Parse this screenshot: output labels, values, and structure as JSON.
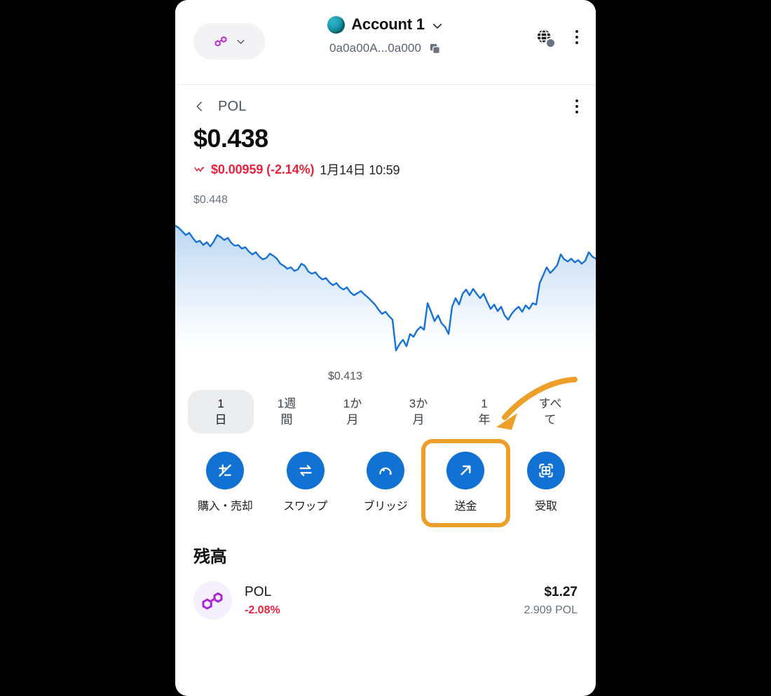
{
  "header": {
    "network_pill": {
      "icon": "polygon-icon",
      "chevron": "chevron-down-icon"
    },
    "account_name": "Account 1",
    "account_chevron": "chevron-down-icon",
    "address": "0a0a00A...0a000",
    "copy_icon": "copy-icon",
    "globe_icon": "globe-network-icon",
    "menu_icon": "kebab-menu-icon"
  },
  "asset": {
    "back_icon": "chevron-left-icon",
    "symbol": "POL",
    "menu_icon": "kebab-menu-icon",
    "price": "$0.438",
    "trend_icon": "trend-down-icon",
    "change": "$0.00959 (-2.14%)",
    "timestamp": "1月14日 10:59",
    "change_color": "#e8233f"
  },
  "chart_data": {
    "type": "line",
    "title": "POL price",
    "high_label": "$0.448",
    "low_label": "$0.413",
    "ylim": [
      0.41,
      0.45
    ],
    "ylabel": "",
    "xlabel": "",
    "grid": false,
    "legend": null,
    "line_color": "#1672d4",
    "fill_color": "#cfe2f7",
    "x": [
      0,
      1,
      2,
      3,
      4,
      5,
      6,
      7,
      8,
      9,
      10,
      11,
      12,
      13,
      14,
      15,
      16,
      17,
      18,
      19,
      20,
      21,
      22,
      23,
      24,
      25,
      26,
      27,
      28,
      29,
      30,
      31,
      32,
      33,
      34,
      35,
      36,
      37,
      38,
      39,
      40,
      41,
      42,
      43,
      44,
      45,
      46,
      47,
      48,
      49,
      50,
      51,
      52,
      53,
      54,
      55,
      56,
      57,
      58,
      59,
      60,
      61,
      62,
      63,
      64,
      65,
      66,
      67,
      68,
      69,
      70,
      71,
      72,
      73,
      74,
      75,
      76,
      77,
      78,
      79,
      80,
      81,
      82,
      83,
      84,
      85,
      86,
      87,
      88,
      89,
      90,
      91,
      92,
      93,
      94,
      95,
      96,
      97,
      98,
      99,
      100,
      101,
      102,
      103,
      104,
      105,
      106,
      107,
      108,
      109,
      110,
      111,
      112,
      113,
      114,
      115,
      116,
      117,
      118,
      119
    ],
    "values": [
      0.4478,
      0.4472,
      0.4462,
      0.4452,
      0.4458,
      0.4444,
      0.4432,
      0.4436,
      0.4424,
      0.4432,
      0.442,
      0.4434,
      0.4452,
      0.4446,
      0.4438,
      0.4444,
      0.443,
      0.4422,
      0.4424,
      0.4414,
      0.4418,
      0.4406,
      0.4398,
      0.4404,
      0.4392,
      0.4384,
      0.4388,
      0.44,
      0.4394,
      0.4386,
      0.4372,
      0.4366,
      0.4358,
      0.4362,
      0.4352,
      0.4356,
      0.4372,
      0.4366,
      0.435,
      0.4344,
      0.4348,
      0.4336,
      0.4328,
      0.4332,
      0.432,
      0.4312,
      0.4318,
      0.4306,
      0.43,
      0.4306,
      0.4292,
      0.4284,
      0.429,
      0.4296,
      0.4286,
      0.4278,
      0.4268,
      0.4258,
      0.4244,
      0.4232,
      0.4238,
      0.4226,
      0.4216,
      0.413,
      0.4148,
      0.416,
      0.4142,
      0.4176,
      0.4168,
      0.4186,
      0.4196,
      0.4188,
      0.4262,
      0.4238,
      0.4212,
      0.4228,
      0.4206,
      0.4196,
      0.4176,
      0.4252,
      0.4276,
      0.4258,
      0.4288,
      0.43,
      0.4284,
      0.4302,
      0.4288,
      0.4276,
      0.4288,
      0.4266,
      0.4246,
      0.4258,
      0.424,
      0.4252,
      0.4228,
      0.4216,
      0.4232,
      0.4244,
      0.4252,
      0.4238,
      0.4256,
      0.4246,
      0.4262,
      0.4258,
      0.4318,
      0.434,
      0.4362,
      0.4346,
      0.4356,
      0.4368,
      0.4398,
      0.4384,
      0.4378,
      0.4386,
      0.4376,
      0.4382,
      0.4372,
      0.438,
      0.4404,
      0.4392,
      0.4386
    ]
  },
  "ranges": [
    {
      "line1": "1",
      "line2": "日",
      "selected": true
    },
    {
      "line1": "1週",
      "line2": "間",
      "selected": false
    },
    {
      "line1": "1か",
      "line2": "月",
      "selected": false
    },
    {
      "line1": "3か",
      "line2": "月",
      "selected": false
    },
    {
      "line1": "1",
      "line2": "年",
      "selected": false
    },
    {
      "line1": "すべ",
      "line2": "て",
      "selected": false
    }
  ],
  "actions": [
    {
      "label": "購入・売却",
      "icon": "buy-sell-icon",
      "highlighted": false
    },
    {
      "label": "スワップ",
      "icon": "swap-icon",
      "highlighted": false
    },
    {
      "label": "ブリッジ",
      "icon": "bridge-icon",
      "highlighted": false
    },
    {
      "label": "送金",
      "icon": "send-arrow-icon",
      "highlighted": true
    },
    {
      "label": "受取",
      "icon": "receive-qr-icon",
      "highlighted": false
    }
  ],
  "balance": {
    "title": "残高",
    "rows": [
      {
        "icon": "polygon-token-icon",
        "name": "POL",
        "change": "-2.08%",
        "fiat": "$1.27",
        "amount": "2.909 POL"
      }
    ]
  },
  "annotation": {
    "arrow_color": "#eda029",
    "highlight_color": "#eda029",
    "points_to": "送金"
  },
  "colors": {
    "accent_blue": "#1272d3",
    "negative_red": "#e8233f",
    "polygon_purple": "#a726d9"
  }
}
